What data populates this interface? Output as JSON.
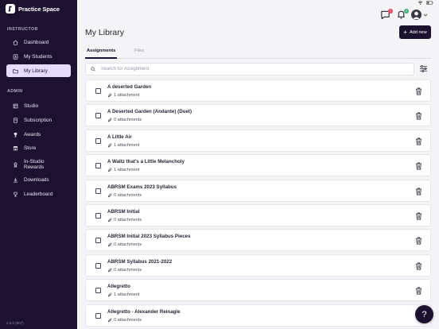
{
  "app": {
    "brand": "Practice Space",
    "version": "2.8.0 (907)"
  },
  "colors": {
    "sidebar_bg": "#1c1230",
    "active_item_bg": "#e5dcfa",
    "accent": "#1c1230",
    "badge_red": "#e0455a",
    "badge_green": "#3bb07a"
  },
  "sidebar": {
    "instructor_label": "INSTRUCTOR",
    "admin_label": "ADMIN",
    "instructor_items": [
      {
        "label": "Dashboard",
        "icon": "house-icon"
      },
      {
        "label": "My Students",
        "icon": "students-icon"
      },
      {
        "label": "My Library",
        "icon": "folder-icon",
        "active": true
      }
    ],
    "admin_items": [
      {
        "label": "Studio",
        "icon": "studio-icon"
      },
      {
        "label": "Subscription",
        "icon": "subscription-icon"
      },
      {
        "label": "Awards",
        "icon": "trophy-icon"
      },
      {
        "label": "Store",
        "icon": "store-icon"
      },
      {
        "label": "In-Studio Rewards",
        "label_line1": "In-Studio",
        "label_line2": "Rewards",
        "icon": "rewards-icon"
      },
      {
        "label": "Downloads",
        "icon": "download-icon"
      },
      {
        "label": "Leaderboard",
        "icon": "leaderboard-icon"
      }
    ]
  },
  "header": {
    "title": "My Library",
    "add_button": "Add new",
    "messages_badge": "1",
    "notifications_badge": "2"
  },
  "tabs": [
    {
      "label": "Assignments",
      "active": true
    },
    {
      "label": "Files",
      "active": false
    }
  ],
  "search": {
    "placeholder": "Search for Assignment",
    "value": ""
  },
  "assignments": [
    {
      "title": "A deserted Garden",
      "attachments": "1 attachment"
    },
    {
      "title": "A Deserted Garden (Andante) (Duet)",
      "attachments": "0 attachments"
    },
    {
      "title": "A Little Air",
      "attachments": "1 attachment"
    },
    {
      "title": "A Waltz that's a Little Melancholy",
      "attachments": "1 attachment"
    },
    {
      "title": "ABRSM Exams 2023 Syllabus",
      "attachments": "0 attachments"
    },
    {
      "title": "ABRSM Initial",
      "attachments": "0 attachments"
    },
    {
      "title": "ABRSM Initial 2023 Syllabus Pieces",
      "attachments": "0 attachments"
    },
    {
      "title": "ABRSM Syllabus 2021-2022",
      "attachments": "0 attachments"
    },
    {
      "title": "Allegretto",
      "attachments": "1 attachment"
    },
    {
      "title": "Allegretto - Alexander Reinagle",
      "attachments": "0 attachments"
    }
  ],
  "help_button": "?"
}
